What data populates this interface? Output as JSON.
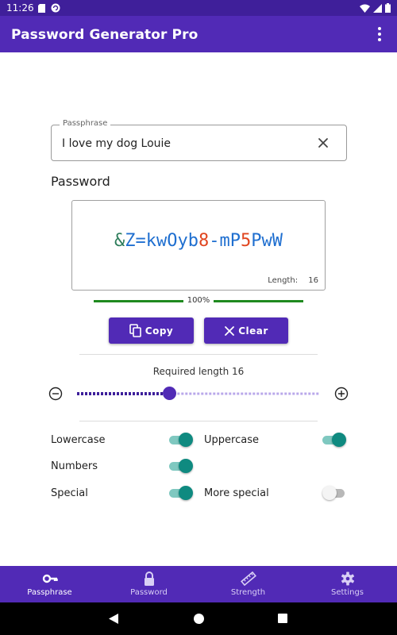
{
  "status_bar": {
    "time": "11:26"
  },
  "app_bar": {
    "title": "Password Generator Pro",
    "menu_icon": "more-vert-icon"
  },
  "passphrase": {
    "label": "Passphrase",
    "value": "I love my dog Louie"
  },
  "password": {
    "section_title": "Password",
    "segments": [
      {
        "text": "&",
        "color": "#2e7d5b"
      },
      {
        "text": "Z=kwOyb",
        "color": "#1f6fd0"
      },
      {
        "text": "8",
        "color": "#e0451f"
      },
      {
        "text": "-mP",
        "color": "#1f6fd0"
      },
      {
        "text": "5",
        "color": "#e0451f"
      },
      {
        "text": "PwW",
        "color": "#1f6fd0"
      }
    ],
    "length_label": "Length:",
    "length_value": "16"
  },
  "strength": {
    "percent_label": "100%",
    "percent": 100,
    "color": "#1f8a1f"
  },
  "buttons": {
    "copy": "Copy",
    "clear": "Clear"
  },
  "length_slider": {
    "label": "Required length 16",
    "value": 16,
    "fraction": 0.38
  },
  "options": {
    "lowercase": {
      "label": "Lowercase",
      "on": true
    },
    "uppercase": {
      "label": "Uppercase",
      "on": true
    },
    "numbers": {
      "label": "Numbers",
      "on": true
    },
    "special": {
      "label": "Special",
      "on": true
    },
    "more_special": {
      "label": "More special",
      "on": false
    }
  },
  "bottom_nav": [
    {
      "label": "Passphrase",
      "icon": "key-icon",
      "active": true
    },
    {
      "label": "Password",
      "icon": "lock-icon",
      "active": false
    },
    {
      "label": "Strength",
      "icon": "ruler-icon",
      "active": false
    },
    {
      "label": "Settings",
      "icon": "gear-icon",
      "active": false
    }
  ],
  "colors": {
    "primary": "#512ab6",
    "status_bar": "#3f1f9a",
    "accent": "#0f8a80"
  }
}
